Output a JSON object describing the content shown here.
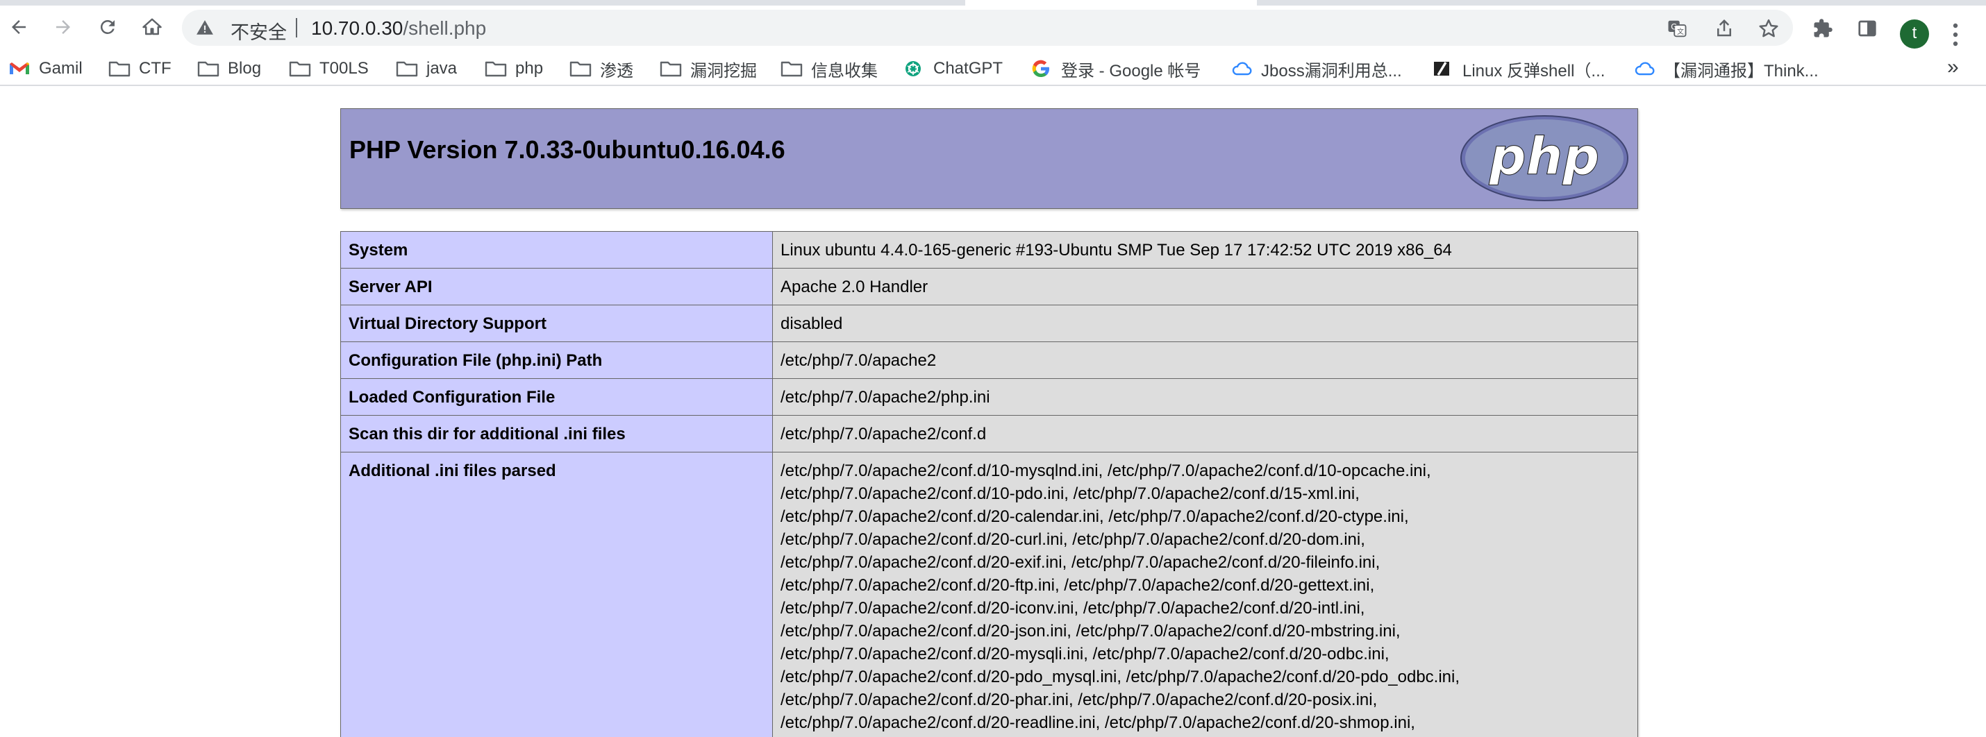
{
  "browser": {
    "security_label": "不安全",
    "url_host": "10.70.0.30",
    "url_path": "/shell.php",
    "profile_initial": "t",
    "more_bookmarks": "»"
  },
  "bookmarks": [
    {
      "label": "Gamil",
      "icon": "gmail-icon"
    },
    {
      "label": "CTF",
      "icon": "folder-icon"
    },
    {
      "label": "Blog",
      "icon": "folder-icon"
    },
    {
      "label": "T00LS",
      "icon": "folder-icon"
    },
    {
      "label": "java",
      "icon": "folder-icon"
    },
    {
      "label": "php",
      "icon": "folder-icon"
    },
    {
      "label": "渗透",
      "icon": "folder-icon"
    },
    {
      "label": "漏洞挖掘",
      "icon": "folder-icon"
    },
    {
      "label": "信息收集",
      "icon": "folder-icon"
    },
    {
      "label": "ChatGPT",
      "icon": "chatgpt-icon"
    },
    {
      "label": "登录 - Google 帐号",
      "icon": "google-icon"
    },
    {
      "label": "Jboss漏洞利用总...",
      "icon": "cloud-icon"
    },
    {
      "label": "Linux 反弹shell（...",
      "icon": "slash-icon"
    },
    {
      "label": "【漏洞通报】Think...",
      "icon": "cloud-icon"
    }
  ],
  "phpinfo": {
    "title": "PHP Version 7.0.33-0ubuntu0.16.04.6",
    "logo_text": "php",
    "rows": [
      {
        "key": "System",
        "value": "Linux ubuntu 4.4.0-165-generic #193-Ubuntu SMP Tue Sep 17 17:42:52 UTC 2019 x86_64"
      },
      {
        "key": "Server API",
        "value": "Apache 2.0 Handler"
      },
      {
        "key": "Virtual Directory Support",
        "value": "disabled"
      },
      {
        "key": "Configuration File (php.ini) Path",
        "value": "/etc/php/7.0/apache2"
      },
      {
        "key": "Loaded Configuration File",
        "value": "/etc/php/7.0/apache2/php.ini"
      },
      {
        "key": "Scan this dir for additional .ini files",
        "value": "/etc/php/7.0/apache2/conf.d"
      }
    ],
    "additional_key": "Additional .ini files parsed",
    "additional_lines": [
      "/etc/php/7.0/apache2/conf.d/10-mysqlnd.ini, /etc/php/7.0/apache2/conf.d/10-opcache.ini,",
      "/etc/php/7.0/apache2/conf.d/10-pdo.ini, /etc/php/7.0/apache2/conf.d/15-xml.ini,",
      "/etc/php/7.0/apache2/conf.d/20-calendar.ini, /etc/php/7.0/apache2/conf.d/20-ctype.ini,",
      "/etc/php/7.0/apache2/conf.d/20-curl.ini, /etc/php/7.0/apache2/conf.d/20-dom.ini,",
      "/etc/php/7.0/apache2/conf.d/20-exif.ini, /etc/php/7.0/apache2/conf.d/20-fileinfo.ini,",
      "/etc/php/7.0/apache2/conf.d/20-ftp.ini, /etc/php/7.0/apache2/conf.d/20-gettext.ini,",
      "/etc/php/7.0/apache2/conf.d/20-iconv.ini, /etc/php/7.0/apache2/conf.d/20-intl.ini,",
      "/etc/php/7.0/apache2/conf.d/20-json.ini, /etc/php/7.0/apache2/conf.d/20-mbstring.ini,",
      "/etc/php/7.0/apache2/conf.d/20-mysqli.ini, /etc/php/7.0/apache2/conf.d/20-odbc.ini,",
      "/etc/php/7.0/apache2/conf.d/20-pdo_mysql.ini, /etc/php/7.0/apache2/conf.d/20-pdo_odbc.ini,",
      "/etc/php/7.0/apache2/conf.d/20-phar.ini, /etc/php/7.0/apache2/conf.d/20-posix.ini,",
      "/etc/php/7.0/apache2/conf.d/20-readline.ini, /etc/php/7.0/apache2/conf.d/20-shmop.ini,"
    ]
  }
}
